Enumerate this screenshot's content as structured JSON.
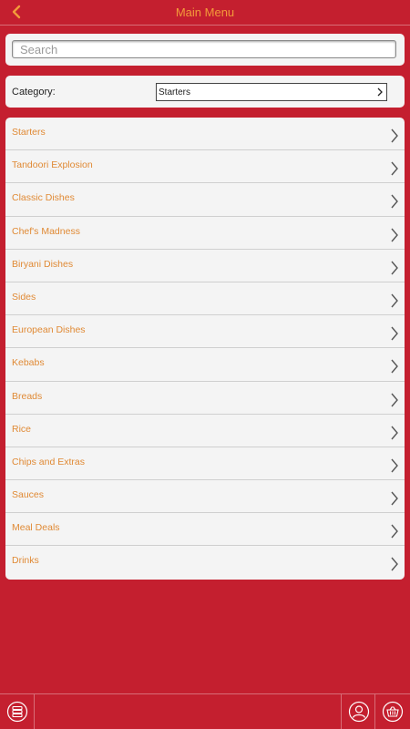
{
  "header": {
    "title": "Main Menu",
    "back_icon": "chevron-left-icon"
  },
  "search": {
    "placeholder": "Search",
    "value": ""
  },
  "category": {
    "label": "Category:",
    "selected": "Starters"
  },
  "menu": {
    "items": [
      {
        "label": "Starters"
      },
      {
        "label": "Tandoori Explosion"
      },
      {
        "label": "Classic Dishes"
      },
      {
        "label": "Chef's Madness"
      },
      {
        "label": "Biryani Dishes"
      },
      {
        "label": "Sides"
      },
      {
        "label": "European Dishes"
      },
      {
        "label": "Kebabs"
      },
      {
        "label": "Breads"
      },
      {
        "label": "Rice"
      },
      {
        "label": "Chips and Extras"
      },
      {
        "label": "Sauces"
      },
      {
        "label": "Meal Deals"
      },
      {
        "label": "Drinks"
      }
    ]
  },
  "footer": {
    "icons": [
      "menu-list-icon",
      "user-icon",
      "basket-icon"
    ]
  },
  "colors": {
    "background": "#c41f2f",
    "accent": "#f39a3a",
    "item_text": "#e08a35",
    "panel": "#f4f4f4"
  }
}
